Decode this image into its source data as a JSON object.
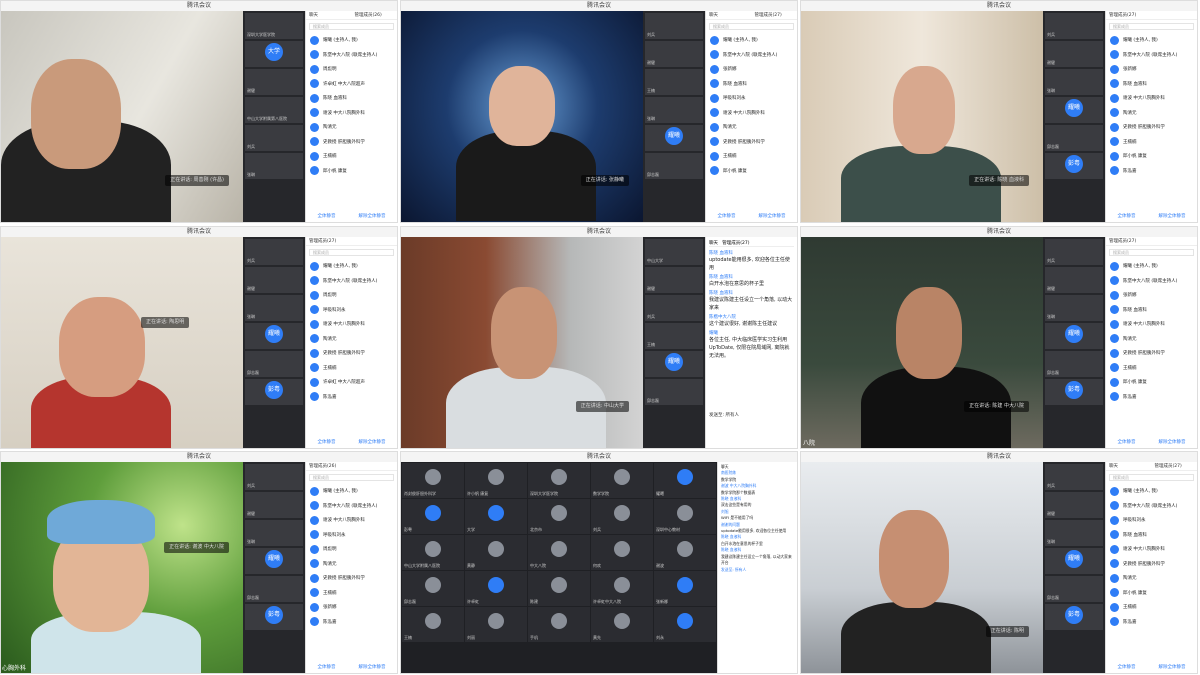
{
  "app_title": "腾讯会议",
  "tabs": {
    "chat": "聊天",
    "members": "管理成员(27)",
    "members26": "管理成员(26)"
  },
  "search_placeholder": "搜索成员",
  "footer": {
    "mute_all": "全体静音",
    "unmute_all": "解除全体静音"
  },
  "speaking_labels": {
    "p1": "正在讲话: 周善刚 (许昌)",
    "p2": "正在讲话: 张静曦",
    "p3": "正在讲话: 陈晓 血液科",
    "p4": "正在讲话: 陶思明",
    "p5": "正在讲话: 中山大学",
    "p6": "正在讲话: 陈建 中大八院",
    "p7": "正在讲话: 谢波 中大八院",
    "p9": "正在讲话: 陈明"
  },
  "members": [
    "耀曦 (主持人, 我)",
    "陈堡中大八院 (联席主持人)",
    "周彪明",
    "许卓虹 中大八院超声",
    "陈晓 血液科",
    "谢波 中大八院胸外科",
    "陶清元",
    "史教授 肝胆胰外科学",
    "王楠楠",
    "邱小帆 康复",
    "陈泓嘉",
    "张新娜",
    "呼吸科刘永"
  ],
  "thumb_names": [
    "深圳大学医学院",
    "大学",
    "谢健",
    "中山大学附属第八医院",
    "刘兵",
    "彭粤",
    "耀曦",
    "王楠",
    "邱志磊",
    "张琳",
    "中山大学"
  ],
  "chat_panel": {
    "n1": "陈晓 血液科",
    "m1": "uptodate能用很多, 欢迎各位主任使用",
    "n2": "陈晓 血液科",
    "m2": "白开水泡在意思的杯子里",
    "n3": "陈晓 血液科",
    "m3": "我建议陈建主任设立一个角落, 以动大家来",
    "n4": "陈楷中大八院",
    "m4": "这个建议很好, 谢谢陈主任建议",
    "n5": "耀曦",
    "m5": "各位主任, 中大临床医学实习生利用UpToDate, 仅限在院局域网, 离院就无法用。",
    "send_to": "发送至: 所有人"
  },
  "gallery_names": [
    "肖封俊肝胆外科学",
    "许小帆 康复",
    "深圳大学医学院",
    "数学学院",
    "耀曦",
    "彭粤",
    "大学",
    "北京市",
    "刘兵",
    "深圳中心教材",
    "中山大学附属八医院",
    "黄静",
    "中大八院",
    "何欢",
    "谢波",
    "邱志磊",
    "许卓虹",
    "陈建",
    "许卓虹中大八院",
    "张新娜",
    "王楠",
    "刘丽",
    "手机",
    "黄先",
    "刘永"
  ],
  "gallery_chat": [
    "南医院练",
    "数学学院",
    "谢波 中大八院胸外科",
    "数学学院那个数据表",
    "陈晓 血液科",
    "双击这些是有用的",
    "刘旭",
    "WIFI 是不能用了吗",
    "谢谢的问题",
    "uptodate能用很多, 欢迎各位主任使用",
    "陈晓 血液科",
    "白开水泡在意思的杯子里",
    "陈晓 血液科",
    "我建议陈建主任设立一个角落, 以动大家来开台",
    "发送至: 所有人"
  ],
  "bottom_labels": {
    "row2": "八院",
    "row3": "心胸外科"
  }
}
